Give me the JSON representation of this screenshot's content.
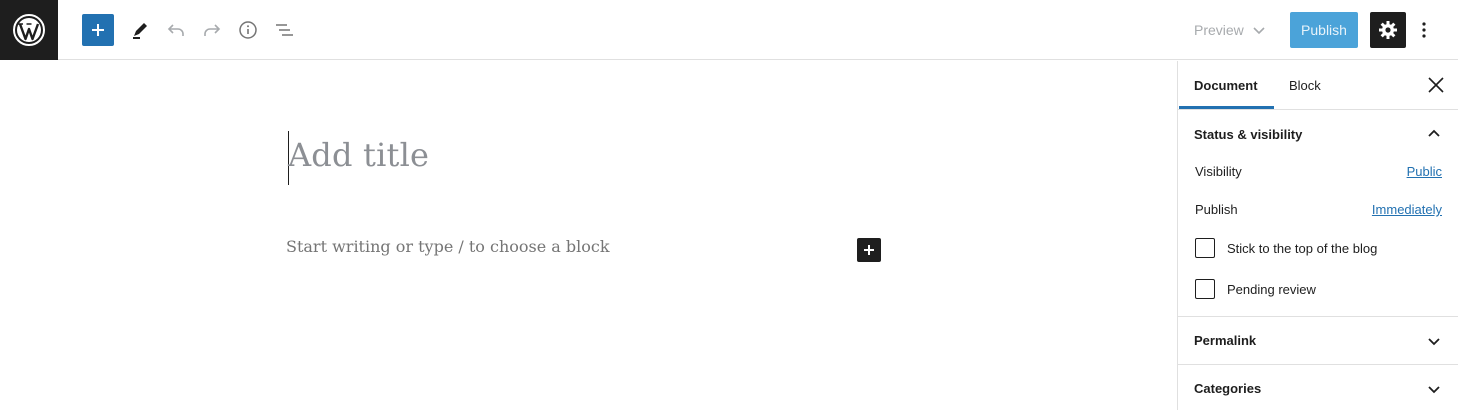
{
  "toolbar": {
    "logo_icon": "wordpress-icon",
    "add_icon": "plus-icon",
    "tools_icon": "pencil-icon",
    "undo_icon": "undo-icon",
    "redo_icon": "redo-icon",
    "info_icon": "info-icon",
    "outline_icon": "list-view-icon",
    "preview_label": "Preview",
    "publish_label": "Publish",
    "settings_icon": "gear-icon",
    "more_icon": "more-vertical-icon"
  },
  "editor": {
    "title_placeholder": "Add title",
    "block_placeholder": "Start writing or type / to choose a block"
  },
  "sidebar": {
    "tabs": [
      {
        "label": "Document",
        "active": true
      },
      {
        "label": "Block",
        "active": false
      }
    ],
    "status": {
      "heading": "Status & visibility",
      "visibility_label": "Visibility",
      "visibility_value": "Public",
      "publish_label": "Publish",
      "publish_value": "Immediately",
      "sticky_label": "Stick to the top of the blog",
      "pending_label": "Pending review"
    },
    "permalink_heading": "Permalink",
    "categories_heading": "Categories"
  },
  "colors": {
    "accent": "#2271b1",
    "publish_disabled": "#4ba3d9",
    "dark": "#1e1e1e"
  }
}
